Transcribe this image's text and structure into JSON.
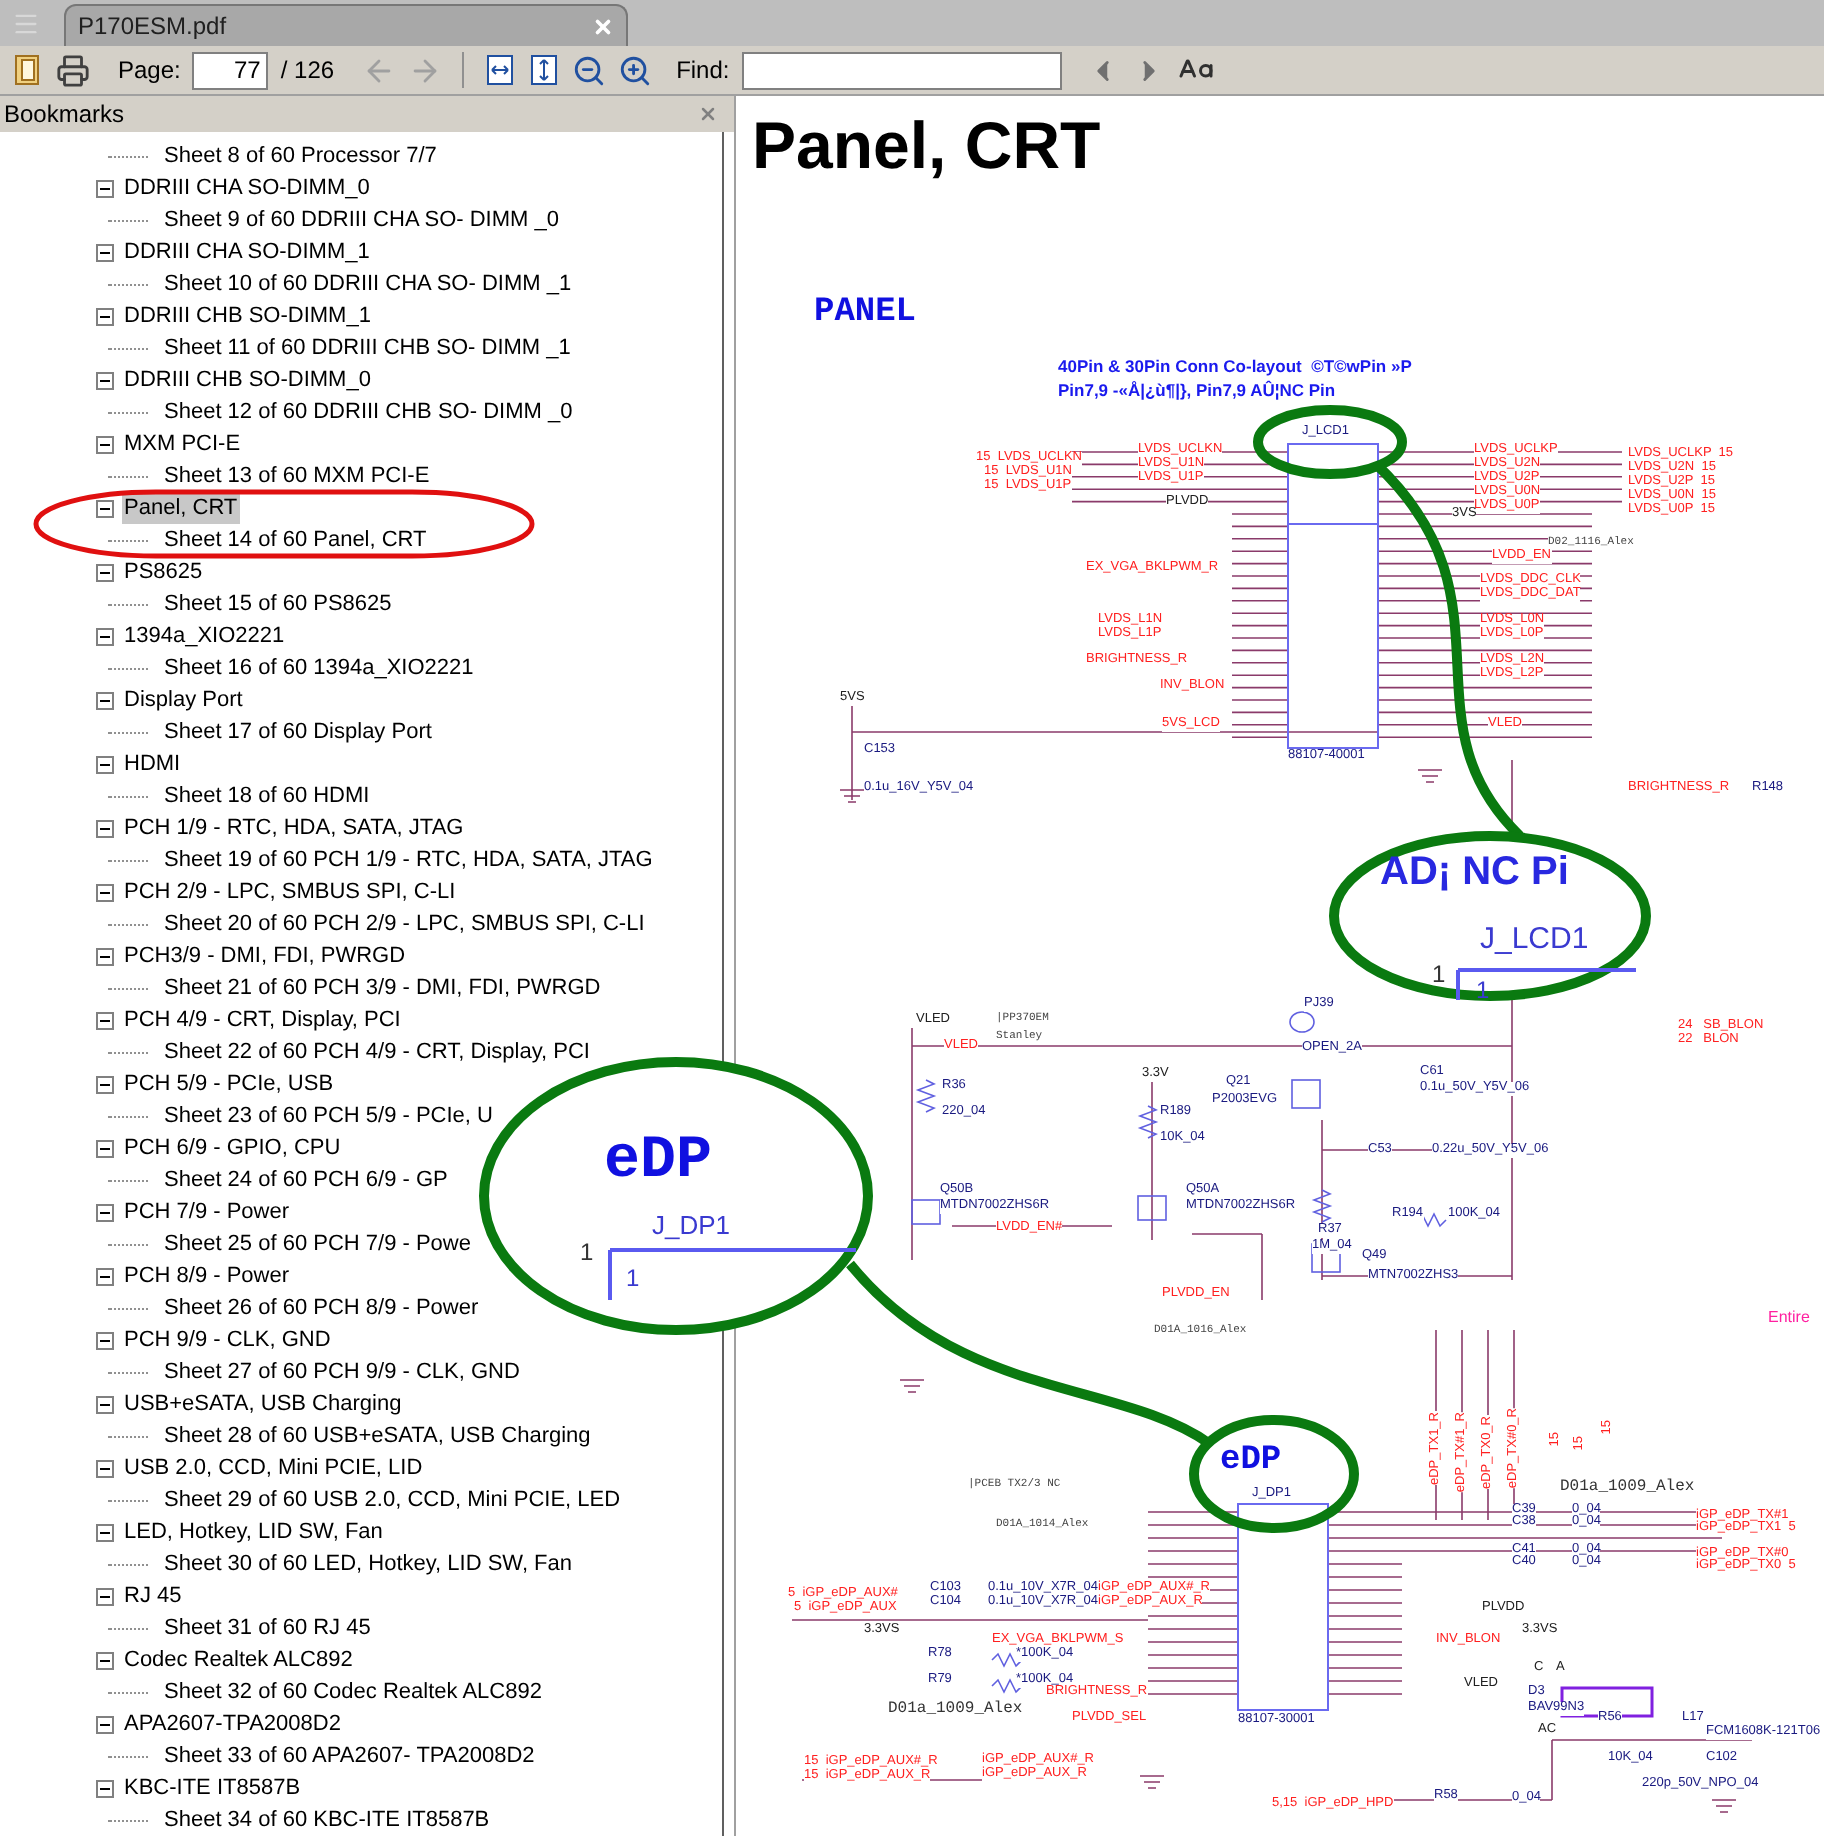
{
  "tab": {
    "title": "P170ESM.pdf"
  },
  "toolbar": {
    "page_label": "Page:",
    "page_value": "77",
    "page_total": "/ 126",
    "find_label": "Find:"
  },
  "bookmarks": {
    "title": "Bookmarks",
    "continued_sheet": "Sheet 8 of 60 Processor 7/7",
    "items": [
      {
        "label": "DDRIII CHA SO-DIMM_0",
        "expanded": true,
        "selected": false,
        "children": [
          {
            "label": "Sheet 9 of 60 DDRIII CHA SO- DIMM _0"
          }
        ]
      },
      {
        "label": "DDRIII CHA SO-DIMM_1",
        "expanded": true,
        "selected": false,
        "children": [
          {
            "label": "Sheet 10 of 60 DDRIII CHA SO- DIMM _1"
          }
        ]
      },
      {
        "label": "DDRIII CHB SO-DIMM_1",
        "expanded": true,
        "selected": false,
        "children": [
          {
            "label": "Sheet 11 of 60 DDRIII CHB SO- DIMM _1"
          }
        ]
      },
      {
        "label": "DDRIII CHB SO-DIMM_0",
        "expanded": true,
        "selected": false,
        "children": [
          {
            "label": "Sheet 12 of 60 DDRIII CHB SO- DIMM _0"
          }
        ]
      },
      {
        "label": "MXM PCI-E",
        "expanded": true,
        "selected": false,
        "children": [
          {
            "label": "Sheet 13 of 60 MXM PCI-E"
          }
        ]
      },
      {
        "label": "Panel, CRT",
        "expanded": true,
        "selected": true,
        "children": [
          {
            "label": "Sheet 14 of 60 Panel, CRT"
          }
        ]
      },
      {
        "label": "PS8625",
        "expanded": true,
        "selected": false,
        "children": [
          {
            "label": "Sheet 15 of 60 PS8625"
          }
        ]
      },
      {
        "label": "1394a_XIO2221",
        "expanded": true,
        "selected": false,
        "children": [
          {
            "label": "Sheet 16 of 60 1394a_XIO2221"
          }
        ]
      },
      {
        "label": "Display Port",
        "expanded": true,
        "selected": false,
        "children": [
          {
            "label": "Sheet 17 of 60 Display Port"
          }
        ]
      },
      {
        "label": "HDMI",
        "expanded": true,
        "selected": false,
        "children": [
          {
            "label": "Sheet 18 of 60 HDMI"
          }
        ]
      },
      {
        "label": "PCH 1/9 - RTC, HDA, SATA, JTAG",
        "expanded": true,
        "selected": false,
        "children": [
          {
            "label": "Sheet 19 of 60 PCH 1/9 - RTC, HDA, SATA, JTAG"
          }
        ]
      },
      {
        "label": "PCH 2/9 - LPC, SMBUS SPI, C-LI",
        "expanded": true,
        "selected": false,
        "children": [
          {
            "label": "Sheet 20 of 60 PCH 2/9 - LPC, SMBUS SPI, C-LI"
          }
        ]
      },
      {
        "label": "PCH3/9 - DMI, FDI, PWRGD",
        "expanded": true,
        "selected": false,
        "children": [
          {
            "label": "Sheet 21 of 60 PCH 3/9 - DMI, FDI, PWRGD"
          }
        ]
      },
      {
        "label": "PCH 4/9 - CRT, Display, PCI",
        "expanded": true,
        "selected": false,
        "children": [
          {
            "label": "Sheet 22 of 60 PCH 4/9 - CRT, Display, PCI"
          }
        ]
      },
      {
        "label": "PCH 5/9 - PCIe, USB",
        "expanded": true,
        "selected": false,
        "children": [
          {
            "label": "Sheet 23 of 60 PCH 5/9 - PCIe, U"
          }
        ]
      },
      {
        "label": "PCH 6/9 - GPIO, CPU",
        "expanded": true,
        "selected": false,
        "children": [
          {
            "label": "Sheet 24 of 60 PCH 6/9 - GP"
          }
        ]
      },
      {
        "label": "PCH 7/9 - Power",
        "expanded": true,
        "selected": false,
        "children": [
          {
            "label": "Sheet 25 of 60 PCH 7/9 - Powe"
          }
        ]
      },
      {
        "label": "PCH 8/9 - Power",
        "expanded": true,
        "selected": false,
        "children": [
          {
            "label": "Sheet 26 of 60 PCH 8/9 - Power"
          }
        ]
      },
      {
        "label": "PCH 9/9 - CLK, GND",
        "expanded": true,
        "selected": false,
        "children": [
          {
            "label": "Sheet 27 of 60 PCH 9/9 - CLK, GND"
          }
        ]
      },
      {
        "label": "USB+eSATA, USB Charging",
        "expanded": true,
        "selected": false,
        "children": [
          {
            "label": "Sheet 28 of 60 USB+eSATA, USB Charging"
          }
        ]
      },
      {
        "label": "USB 2.0, CCD, Mini PCIE, LID",
        "expanded": true,
        "selected": false,
        "children": [
          {
            "label": "Sheet 29 of 60 USB 2.0, CCD, Mini PCIE, LED"
          }
        ]
      },
      {
        "label": "LED, Hotkey, LID SW, Fan",
        "expanded": true,
        "selected": false,
        "children": [
          {
            "label": "Sheet 30 of 60 LED, Hotkey, LID SW, Fan"
          }
        ]
      },
      {
        "label": "RJ 45",
        "expanded": true,
        "selected": false,
        "children": [
          {
            "label": "Sheet 31 of 60 RJ 45"
          }
        ]
      },
      {
        "label": "Codec Realtek ALC892",
        "expanded": true,
        "selected": false,
        "children": [
          {
            "label": "Sheet 32 of 60 Codec Realtek ALC892"
          }
        ]
      },
      {
        "label": "APA2607-TPA2008D2",
        "expanded": true,
        "selected": false,
        "children": [
          {
            "label": "Sheet 33 of 60 APA2607- TPA2008D2"
          }
        ]
      },
      {
        "label": "KBC-ITE IT8587B",
        "expanded": true,
        "selected": false,
        "children": [
          {
            "label": "Sheet 34 of 60 KBC-ITE IT8587B"
          }
        ]
      }
    ]
  },
  "page": {
    "heading": "Panel, CRT",
    "labels": [
      {
        "text": "PANEL",
        "kind": "title"
      },
      {
        "text": "40Pin & 30Pin Conn Co-layout  ©T©wPin »P",
        "kind": "note"
      },
      {
        "text": "Pin7,9 -«Å|¿ù¶|}, Pin7,9 AÛ¦NC Pin",
        "kind": "note"
      },
      {
        "text": "J_LCD1",
        "kind": "part"
      },
      {
        "text": "15  LVDS_UCLKN",
        "kind": "net"
      },
      {
        "text": "15  LVDS_U1N",
        "kind": "net"
      },
      {
        "text": "15  LVDS_U1P",
        "kind": "net"
      },
      {
        "text": "LVDS_UCLKN",
        "kind": "net"
      },
      {
        "text": "LVDS_U1N",
        "kind": "net"
      },
      {
        "text": "LVDS_U1P",
        "kind": "net"
      },
      {
        "text": "LVDS_UCLKP",
        "kind": "net"
      },
      {
        "text": "LVDS_U2N",
        "kind": "net"
      },
      {
        "text": "LVDS_U2P",
        "kind": "net"
      },
      {
        "text": "LVDS_U0N",
        "kind": "net"
      },
      {
        "text": "LVDS_U0P",
        "kind": "net"
      },
      {
        "text": "LVDS_UCLKP  15",
        "kind": "net"
      },
      {
        "text": "LVDS_U2N  15",
        "kind": "net"
      },
      {
        "text": "LVDS_U2P  15",
        "kind": "net"
      },
      {
        "text": "LVDS_U0N  15",
        "kind": "net"
      },
      {
        "text": "LVDS_U0P  15",
        "kind": "net"
      },
      {
        "text": "PLVDD",
        "kind": "power"
      },
      {
        "text": "3VS",
        "kind": "power"
      },
      {
        "text": "D02_1116_Alex",
        "kind": "comment"
      },
      {
        "text": "EX_VGA_BKLPWM_R",
        "kind": "net"
      },
      {
        "text": "LVDD_EN",
        "kind": "net"
      },
      {
        "text": "LVDS_DDC_CLK",
        "kind": "net"
      },
      {
        "text": "LVDS_DDC_DAT",
        "kind": "net"
      },
      {
        "text": "LVDS_L1N",
        "kind": "net"
      },
      {
        "text": "LVDS_L1P",
        "kind": "net"
      },
      {
        "text": "LVDS_L0N",
        "kind": "net"
      },
      {
        "text": "LVDS_L0P",
        "kind": "net"
      },
      {
        "text": "BRIGHTNESS_R",
        "kind": "net"
      },
      {
        "text": "LVDS_L2N",
        "kind": "net"
      },
      {
        "text": "LVDS_L2P",
        "kind": "net"
      },
      {
        "text": "INV_BLON",
        "kind": "net"
      },
      {
        "text": "5VS_LCD",
        "kind": "net"
      },
      {
        "text": "VLED",
        "kind": "net"
      },
      {
        "text": "5VS",
        "kind": "power"
      },
      {
        "text": "C153",
        "kind": "part"
      },
      {
        "text": "0.1u_16V_Y5V_04",
        "kind": "part"
      },
      {
        "text": "88107-40001",
        "kind": "part"
      },
      {
        "text": "BRIGHTNESS_R",
        "kind": "net"
      },
      {
        "text": "R148",
        "kind": "part"
      },
      {
        "text": "VLED",
        "kind": "power"
      },
      {
        "text": "|PP370EM",
        "kind": "comment"
      },
      {
        "text": "Stanley",
        "kind": "comment"
      },
      {
        "text": "VLED",
        "kind": "net"
      },
      {
        "text": "R36",
        "kind": "part"
      },
      {
        "text": "220_04",
        "kind": "part"
      },
      {
        "text": "3.3V",
        "kind": "power"
      },
      {
        "text": "R189",
        "kind": "part"
      },
      {
        "text": "10K_04",
        "kind": "part"
      },
      {
        "text": "PJ39",
        "kind": "part"
      },
      {
        "text": "OPEN_2A",
        "kind": "part"
      },
      {
        "text": "Q21",
        "kind": "part"
      },
      {
        "text": "P2003EVG",
        "kind": "part"
      },
      {
        "text": "C61",
        "kind": "part"
      },
      {
        "text": "0.1u_50V_Y5V_06",
        "kind": "part"
      },
      {
        "text": "C53",
        "kind": "part"
      },
      {
        "text": "0.22u_50V_Y5V_06",
        "kind": "part"
      },
      {
        "text": "Q50B",
        "kind": "part"
      },
      {
        "text": "MTDN7002ZHS6R",
        "kind": "part"
      },
      {
        "text": "Q50A",
        "kind": "part"
      },
      {
        "text": "MTDN7002ZHS6R",
        "kind": "part"
      },
      {
        "text": "LVDD_EN#",
        "kind": "net"
      },
      {
        "text": "R37",
        "kind": "part"
      },
      {
        "text": "1M_04",
        "kind": "part"
      },
      {
        "text": "R194",
        "kind": "part"
      },
      {
        "text": "100K_04",
        "kind": "part"
      },
      {
        "text": "Q49",
        "kind": "part"
      },
      {
        "text": "MTN7002ZHS3",
        "kind": "part"
      },
      {
        "text": "PLVDD_EN",
        "kind": "net"
      },
      {
        "text": "D01A_1016_Alex",
        "kind": "comment"
      },
      {
        "text": "24   SB_BLON",
        "kind": "net"
      },
      {
        "text": "22   BLON",
        "kind": "net"
      },
      {
        "text": "Entire",
        "kind": "accent"
      },
      {
        "text": "eDP_TX1_R",
        "kind": "vertical"
      },
      {
        "text": "eDP_TX#1_R",
        "kind": "vertical"
      },
      {
        "text": "eDP_TX0_R",
        "kind": "vertical"
      },
      {
        "text": "eDP_TX#0_R",
        "kind": "vertical"
      },
      {
        "text": "15",
        "kind": "vertical"
      },
      {
        "text": "15",
        "kind": "vertical"
      },
      {
        "text": "15",
        "kind": "vertical"
      },
      {
        "text": "|PCEB TX2/3 NC",
        "kind": "comment"
      },
      {
        "text": "D01A_1014_Alex",
        "kind": "comment"
      },
      {
        "text": "eDP",
        "kind": "title"
      },
      {
        "text": "J_DP1",
        "kind": "part"
      },
      {
        "text": "D01a_1009_Alex",
        "kind": "comment-large"
      },
      {
        "text": "C39",
        "kind": "part"
      },
      {
        "text": "C38",
        "kind": "part"
      },
      {
        "text": "C41",
        "kind": "part"
      },
      {
        "text": "C40",
        "kind": "part"
      },
      {
        "text": "0_04",
        "kind": "part"
      },
      {
        "text": "0_04",
        "kind": "part"
      },
      {
        "text": "0_04",
        "kind": "part"
      },
      {
        "text": "0_04",
        "kind": "part"
      },
      {
        "text": "iGP_eDP_TX#1",
        "kind": "net"
      },
      {
        "text": "iGP_eDP_TX1  5",
        "kind": "net"
      },
      {
        "text": "iGP_eDP_TX#0",
        "kind": "net"
      },
      {
        "text": "iGP_eDP_TX0  5",
        "kind": "net"
      },
      {
        "text": "5  iGP_eDP_AUX#",
        "kind": "net"
      },
      {
        "text": "5  iGP_eDP_AUX",
        "kind": "net"
      },
      {
        "text": "C103",
        "kind": "part"
      },
      {
        "text": "C104",
        "kind": "part"
      },
      {
        "text": "0.1u_10V_X7R_04",
        "kind": "part"
      },
      {
        "text": "0.1u_10V_X7R_04",
        "kind": "part"
      },
      {
        "text": "iGP_eDP_AUX#_R",
        "kind": "net"
      },
      {
        "text": "iGP_eDP_AUX_R",
        "kind": "net"
      },
      {
        "text": "PLVDD",
        "kind": "power"
      },
      {
        "text": "3.3VS",
        "kind": "power"
      },
      {
        "text": "EX_VGA_BKLPWM_S",
        "kind": "net"
      },
      {
        "text": "INV_BLON",
        "kind": "net"
      },
      {
        "text": "3.3VS",
        "kind": "power"
      },
      {
        "text": "R78",
        "kind": "part"
      },
      {
        "text": "*100K_04",
        "kind": "part"
      },
      {
        "text": "R79",
        "kind": "part"
      },
      {
        "text": "*100K_04",
        "kind": "part"
      },
      {
        "text": "BRIGHTNESS_R",
        "kind": "net"
      },
      {
        "text": "D01a_1009_Alex",
        "kind": "comment-large"
      },
      {
        "text": "VLED",
        "kind": "power"
      },
      {
        "text": "C",
        "kind": "power"
      },
      {
        "text": "A",
        "kind": "power"
      },
      {
        "text": "D3",
        "kind": "part"
      },
      {
        "text": "BAV99N3",
        "kind": "part"
      },
      {
        "text": "AC",
        "kind": "power"
      },
      {
        "text": "PLVDD_SEL",
        "kind": "net"
      },
      {
        "text": "88107-30001",
        "kind": "part"
      },
      {
        "text": "R56",
        "kind": "part"
      },
      {
        "text": "L17",
        "kind": "part"
      },
      {
        "text": "FCM1608K-121T06",
        "kind": "part"
      },
      {
        "text": "10K_04",
        "kind": "part"
      },
      {
        "text": "C102",
        "kind": "part"
      },
      {
        "text": "220p_50V_NPO_04",
        "kind": "part"
      },
      {
        "text": "15  iGP_eDP_AUX#_R",
        "kind": "net"
      },
      {
        "text": "15  iGP_eDP_AUX_R",
        "kind": "net"
      },
      {
        "text": "iGP_eDP_AUX#_R",
        "kind": "net"
      },
      {
        "text": "iGP_eDP_AUX_R",
        "kind": "net"
      },
      {
        "text": "5,15  iGP_eDP_HPD",
        "kind": "net"
      },
      {
        "text": "R58",
        "kind": "part"
      },
      {
        "text": "0_04",
        "kind": "part"
      }
    ],
    "insets": [
      {
        "heading": "AD¡ NC Pi",
        "connector": "J_LCD1",
        "pin": "1",
        "pin_outside": "1"
      },
      {
        "heading": "eDP",
        "connector": "J_DP1",
        "pin": "1",
        "pin_outside": "1"
      }
    ]
  }
}
